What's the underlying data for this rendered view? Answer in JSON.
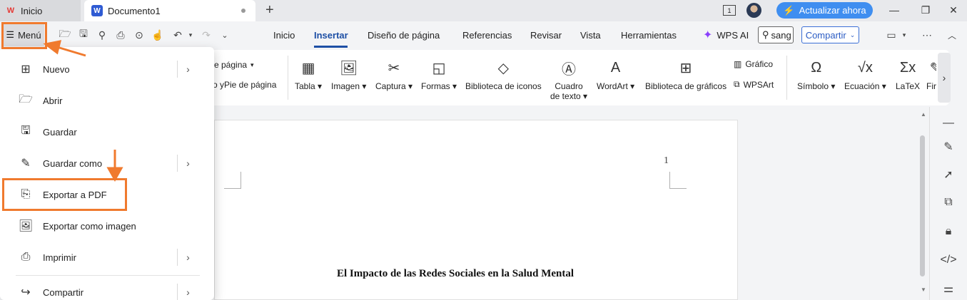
{
  "titlebar": {
    "home_tab": "Inicio",
    "doc_tab": "Documento1",
    "new_tab": "+",
    "upgrade": "Actualizar ahora",
    "window_icon_text": "1"
  },
  "menubar": {
    "menu_label": "Menú",
    "tabs": [
      "Inicio",
      "Insertar",
      "Diseño de página",
      "Referencias",
      "Revisar",
      "Vista",
      "Herramientas"
    ],
    "active_tab": "Insertar",
    "wps_ai": "WPS AI",
    "search_value": "sang",
    "share": "Compartir"
  },
  "ribbon": {
    "page_partial_1": "e página",
    "page_partial_2": "o yPie de página",
    "items": [
      {
        "label": "Tabla",
        "icon": "table-icon"
      },
      {
        "label": "Imagen",
        "icon": "image-icon"
      },
      {
        "label": "Captura",
        "icon": "screenshot-icon"
      },
      {
        "label": "Formas",
        "icon": "shapes-icon"
      },
      {
        "label": "Biblioteca de iconos",
        "icon": "icon-library-icon"
      },
      {
        "label": "Cuadro",
        "label2": "de texto",
        "icon": "textbox-icon"
      },
      {
        "label": "WordArt",
        "icon": "wordart-icon"
      },
      {
        "label": "Biblioteca de gráficos",
        "icon": "chart-library-icon"
      },
      {
        "label": "Símbolo",
        "icon": "symbol-icon"
      },
      {
        "label": "Ecuación",
        "icon": "equation-icon"
      },
      {
        "label": "LaTeX",
        "icon": "latex-icon"
      },
      {
        "label": "Fir",
        "icon": "signature-icon"
      }
    ],
    "grafico": "Gráfico",
    "wpsart": "WPSArt"
  },
  "menu": {
    "items": [
      {
        "label": "Nuevo",
        "icon": "new-icon",
        "submenu": true
      },
      {
        "label": "Abrir",
        "icon": "open-folder-icon",
        "submenu": false
      },
      {
        "label": "Guardar",
        "icon": "save-icon",
        "submenu": false
      },
      {
        "label": "Guardar como",
        "icon": "save-as-icon",
        "submenu": true
      },
      {
        "label": "Exportar a PDF",
        "icon": "export-pdf-icon",
        "submenu": false
      },
      {
        "label": "Exportar como imagen",
        "icon": "export-image-icon",
        "submenu": false
      },
      {
        "label": "Imprimir",
        "icon": "print-icon",
        "submenu": true
      },
      {
        "label": "Compartir",
        "icon": "share-icon",
        "submenu": true
      }
    ]
  },
  "document": {
    "page_number": "1",
    "title": "El Impacto de las Redes Sociales en la Salud Mental"
  },
  "colors": {
    "accent": "#1d4fa5",
    "highlight": "#f07a2e",
    "upgrade": "#3f8ef0"
  }
}
